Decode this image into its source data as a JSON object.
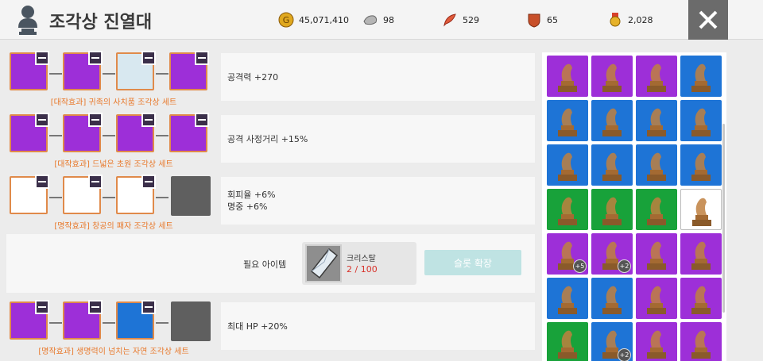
{
  "title": "조각상 진열대",
  "currencies": [
    {
      "icon": "gold-coin-icon",
      "value": "45,071,410"
    },
    {
      "icon": "silver-ore-icon",
      "value": "98"
    },
    {
      "icon": "red-feather-icon",
      "value": "529"
    },
    {
      "icon": "red-crest-icon",
      "value": "65"
    },
    {
      "icon": "medal-icon",
      "value": "2,028"
    }
  ],
  "sets": [
    {
      "name": "[대작효과] 귀족의 사치품 조각상 세트",
      "effects": [
        "공격력 +270"
      ],
      "slots": [
        "purple",
        "purple",
        "white-blue",
        "purple"
      ]
    },
    {
      "name": "[대작효과] 드넓은 초원 조각상 세트",
      "effects": [
        "공격 사정거리 +15%"
      ],
      "slots": [
        "purple",
        "purple",
        "purple",
        "purple"
      ]
    },
    {
      "name": "[명작효과] 창공의 패자 조각상 세트",
      "effects": [
        "회피율 +6%",
        "명중 +6%"
      ],
      "slots": [
        "white",
        "white",
        "white",
        "empty"
      ]
    },
    {
      "name": "[명작효과] 생명력이 넘치는 자연 조각상 세트",
      "effects": [
        "최대 HP +20%"
      ],
      "slots": [
        "purple",
        "purple",
        "blue",
        "empty"
      ]
    }
  ],
  "expand": {
    "required_label": "필요 아이템",
    "item_name": "크리스탈",
    "item_count": "2 / 100",
    "button_label": "슬롯 확장"
  },
  "inventory": [
    {
      "color": "purple"
    },
    {
      "color": "purple"
    },
    {
      "color": "purple"
    },
    {
      "color": "blue"
    },
    {
      "color": "blue"
    },
    {
      "color": "blue"
    },
    {
      "color": "blue"
    },
    {
      "color": "blue"
    },
    {
      "color": "blue"
    },
    {
      "color": "blue"
    },
    {
      "color": "blue"
    },
    {
      "color": "blue"
    },
    {
      "color": "green"
    },
    {
      "color": "green"
    },
    {
      "color": "green"
    },
    {
      "color": "white"
    },
    {
      "color": "purple",
      "badge": "+5"
    },
    {
      "color": "purple",
      "badge": "+2"
    },
    {
      "color": "purple"
    },
    {
      "color": "purple"
    },
    {
      "color": "blue"
    },
    {
      "color": "blue"
    },
    {
      "color": "purple"
    },
    {
      "color": "purple"
    },
    {
      "color": "green"
    },
    {
      "color": "blue",
      "badge": "+2"
    },
    {
      "color": "purple"
    },
    {
      "color": "purple"
    }
  ],
  "colors": {
    "accent_orange": "#e8782a",
    "count_red": "#d8322a",
    "button_teal": "#bfe3e3"
  }
}
